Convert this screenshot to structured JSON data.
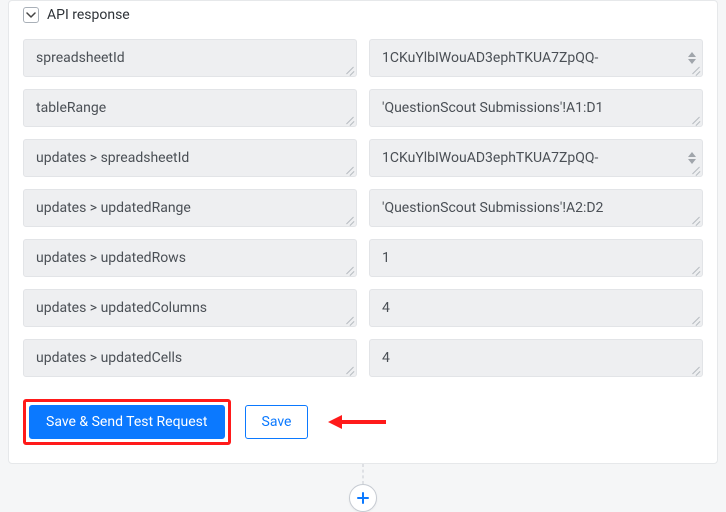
{
  "section": {
    "title": "API response"
  },
  "rows": [
    {
      "label": "spreadsheetId",
      "value": "1CKuYlbIWouAD3ephTKUA7ZpQQ-",
      "spinner": true
    },
    {
      "label": "tableRange",
      "value": "'QuestionScout Submissions'!A1:D1",
      "spinner": false
    },
    {
      "label": "updates > spreadsheetId",
      "value": "1CKuYlbIWouAD3ephTKUA7ZpQQ-",
      "spinner": true
    },
    {
      "label": "updates > updatedRange",
      "value": "'QuestionScout Submissions'!A2:D2",
      "spinner": false
    },
    {
      "label": "updates > updatedRows",
      "value": "1",
      "spinner": false
    },
    {
      "label": "updates > updatedColumns",
      "value": "4",
      "spinner": false
    },
    {
      "label": "updates > updatedCells",
      "value": "4",
      "spinner": false
    }
  ],
  "actions": {
    "primary": "Save & Send Test Request",
    "secondary": "Save"
  }
}
